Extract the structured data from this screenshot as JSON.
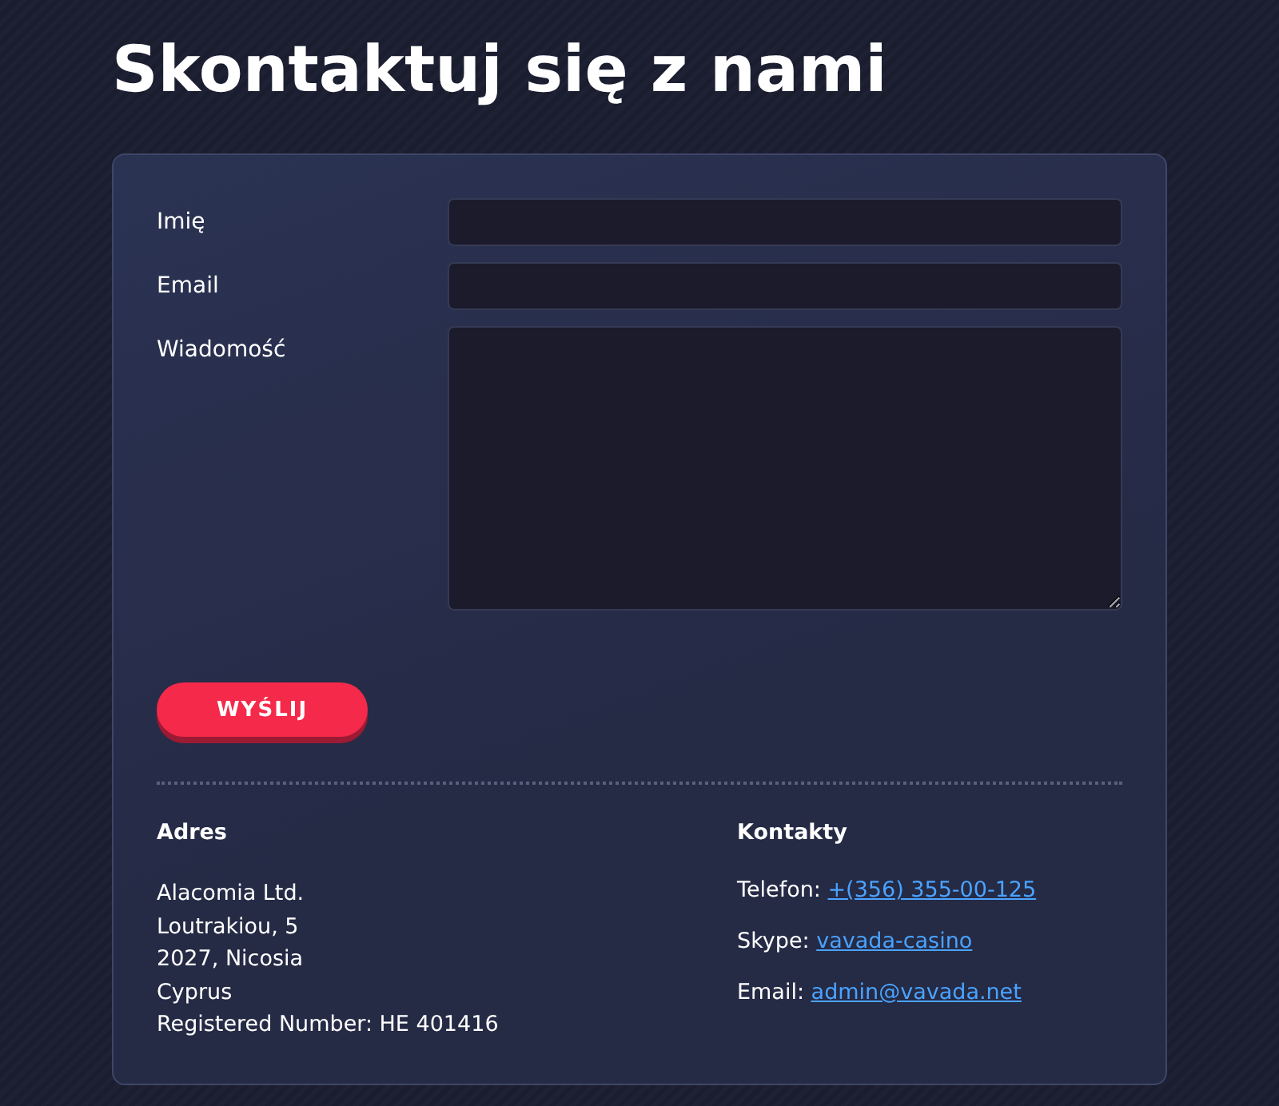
{
  "title": "Skontaktuj się z nami",
  "form": {
    "fields": [
      {
        "label": "Imię",
        "kind": "input"
      },
      {
        "label": "Email",
        "kind": "input"
      },
      {
        "label": "Wiadomość",
        "kind": "textarea"
      }
    ],
    "submit": "WYŚLIJ"
  },
  "address": {
    "heading": "Adres",
    "lines": [
      "Alacomia Ltd.",
      "Loutrakiou, 5",
      "2027, Nicosia",
      "Cyprus",
      "Registered Number: HE 401416"
    ]
  },
  "contacts": {
    "heading": "Kontakty",
    "items": [
      {
        "label": "Telefon:",
        "link": "+(356) 355-00-125"
      },
      {
        "label": "Skype:",
        "link": "vavada-casino"
      },
      {
        "label": "Email:",
        "link": "admin@vavada.net"
      }
    ]
  }
}
